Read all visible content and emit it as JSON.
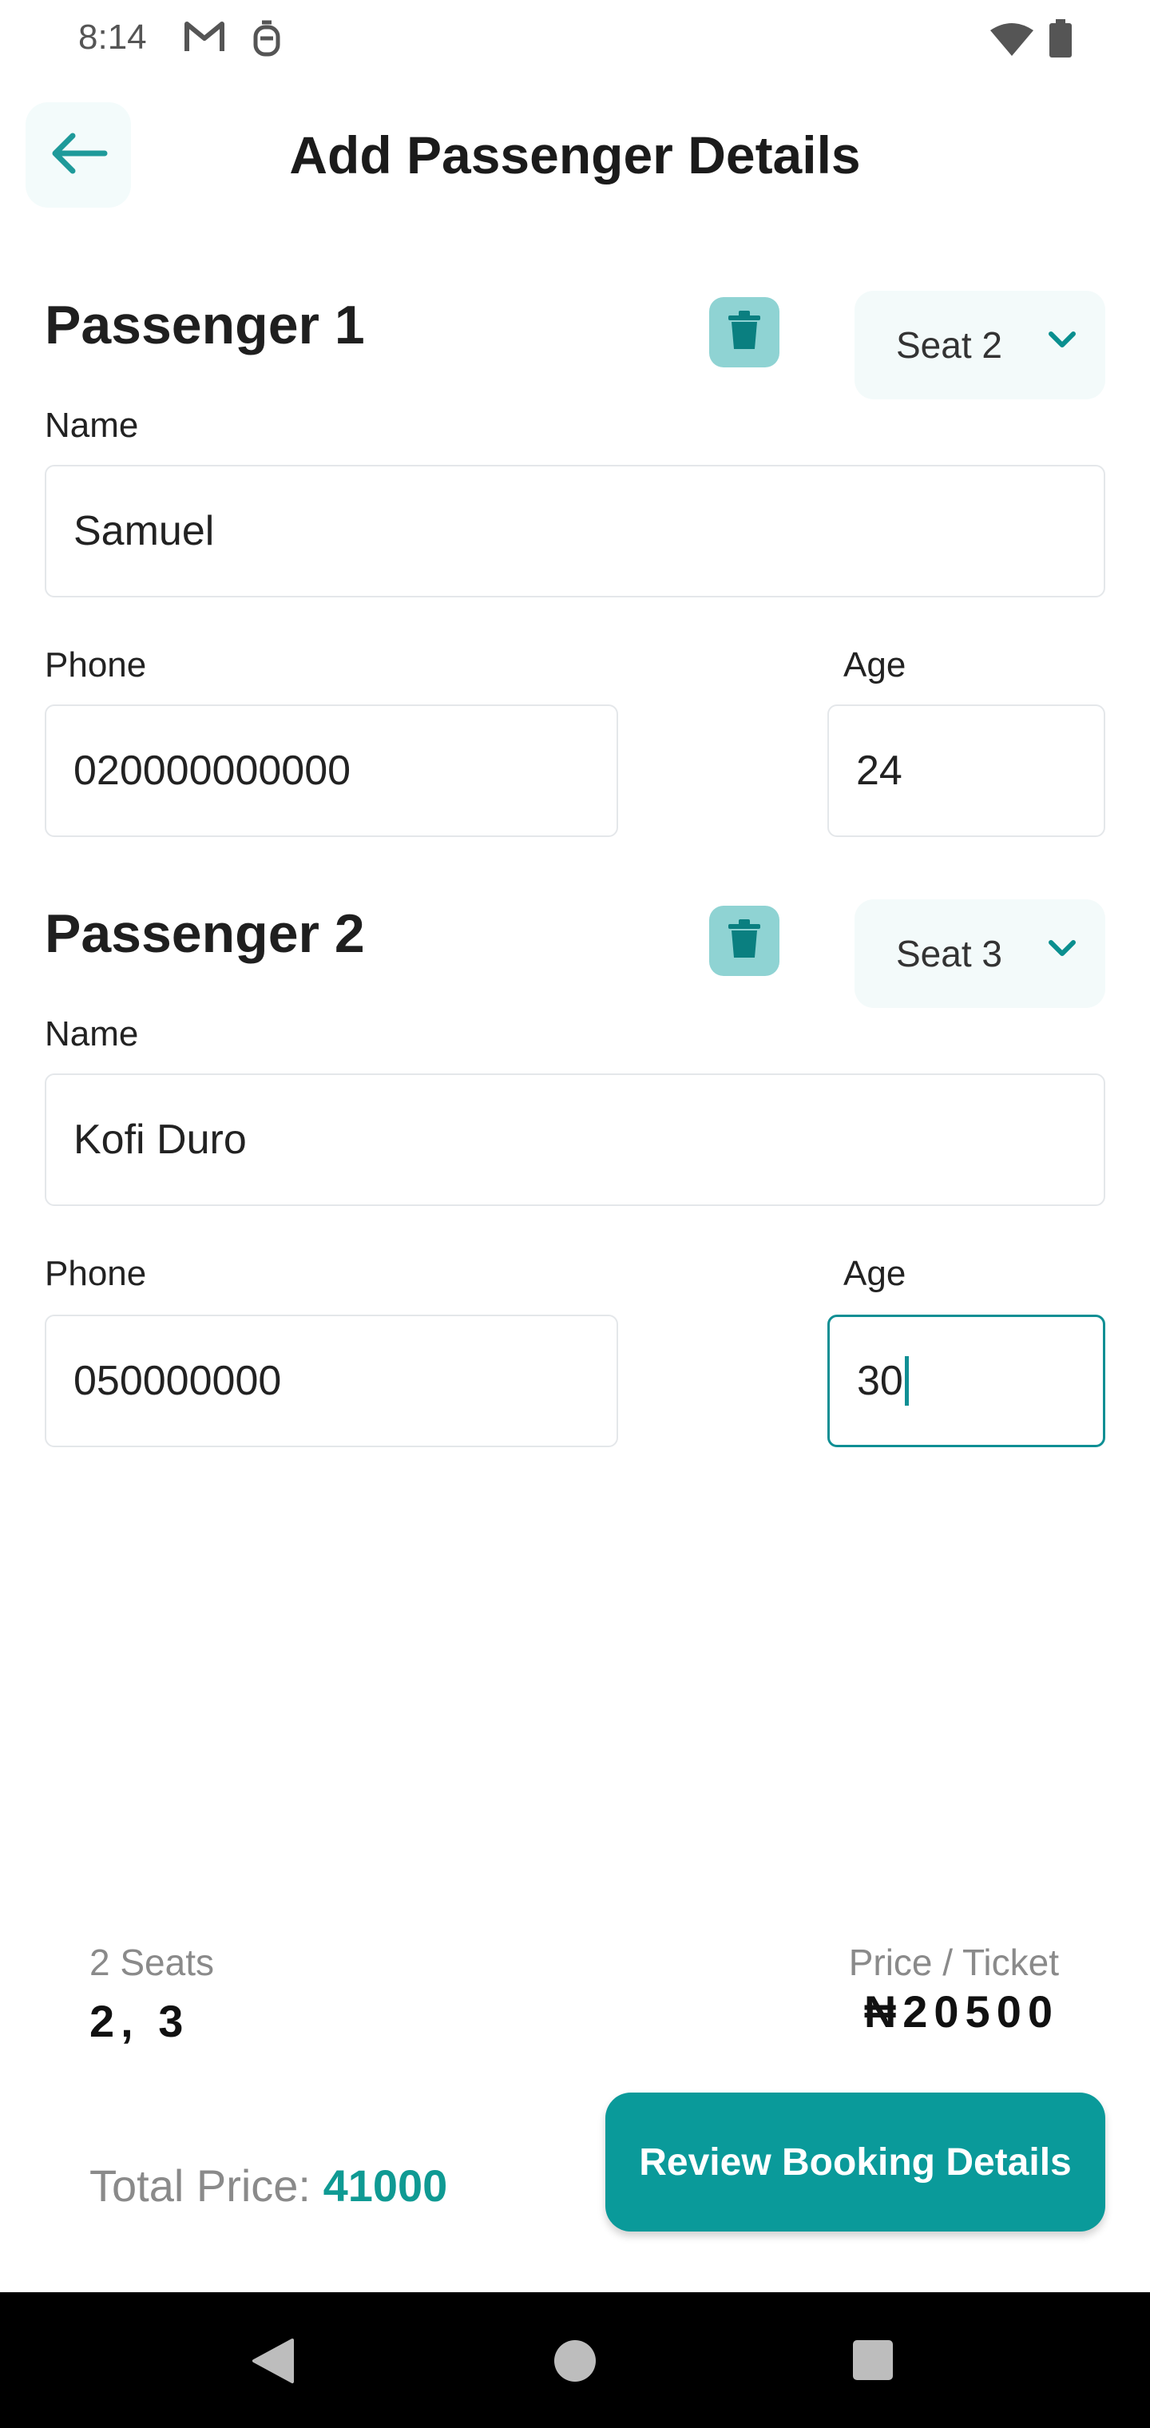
{
  "status_bar": {
    "time": "8:14",
    "icons": [
      "gmail-icon",
      "assistant-icon",
      "wifi-icon",
      "battery-icon"
    ]
  },
  "header": {
    "title": "Add Passenger Details",
    "back_icon": "arrow-left-icon"
  },
  "passengers": [
    {
      "title": "Passenger 1",
      "seat": "Seat 2",
      "name_label": "Name",
      "name_value": "Samuel",
      "phone_label": "Phone",
      "phone_value": "020000000000",
      "age_label": "Age",
      "age_value": "24"
    },
    {
      "title": "Passenger 2",
      "seat": "Seat 3",
      "name_label": "Name",
      "name_value": "Kofi Duro",
      "phone_label": "Phone",
      "phone_value": "050000000",
      "age_label": "Age",
      "age_value": "30"
    }
  ],
  "summary": {
    "seats_label": "2 Seats",
    "seats_value": "2, 3",
    "price_label": "Price / Ticket",
    "price_value": "₦20500",
    "total_label": "Total Price: ",
    "total_value": "41000",
    "review_button": "Review Booking Details"
  },
  "colors": {
    "accent": "#0a9a9a",
    "trash_bg": "#8fd3d3",
    "seat_bg": "#f3fafa"
  }
}
